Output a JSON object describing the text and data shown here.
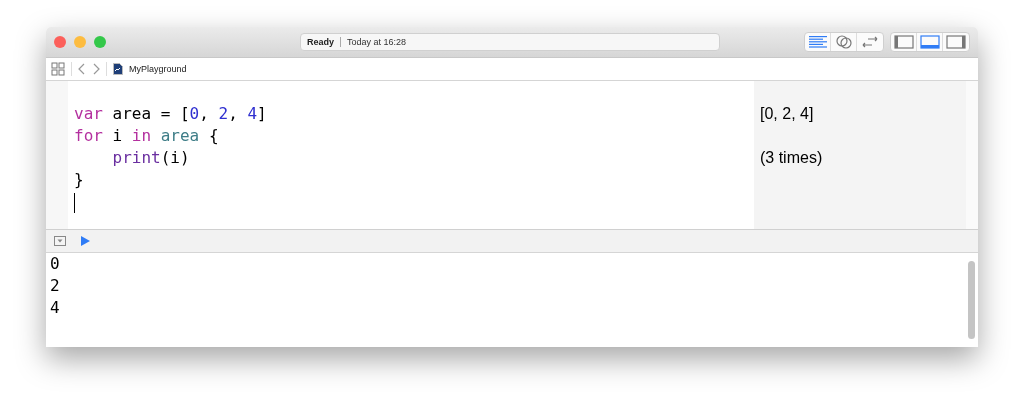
{
  "window": {
    "title_status": "Ready",
    "title_time": "Today at 16:28"
  },
  "toolbar": {
    "editor_modes": [
      {
        "kind": "standard",
        "selected": true
      },
      {
        "kind": "assistant",
        "selected": false
      },
      {
        "kind": "version",
        "selected": false
      }
    ],
    "panels": [
      {
        "kind": "left",
        "selected": false
      },
      {
        "kind": "bottom",
        "selected": true
      },
      {
        "kind": "right",
        "selected": false
      }
    ]
  },
  "jump_bar": {
    "file": "MyPlayground"
  },
  "editor": {
    "lines": [
      {
        "tokens": [
          {
            "text": "var",
            "kind": "keyword"
          },
          {
            "text": " area = [",
            "kind": "plain"
          },
          {
            "text": "0",
            "kind": "number"
          },
          {
            "text": ", ",
            "kind": "plain"
          },
          {
            "text": "2",
            "kind": "number"
          },
          {
            "text": ", ",
            "kind": "plain"
          },
          {
            "text": "4",
            "kind": "number"
          },
          {
            "text": "]",
            "kind": "plain"
          }
        ],
        "result": "[0, 2, 4]"
      },
      {
        "tokens": [
          {
            "text": "for",
            "kind": "keyword"
          },
          {
            "text": " i ",
            "kind": "plain"
          },
          {
            "text": "in",
            "kind": "keyword"
          },
          {
            "text": " area",
            "kind": "variable"
          },
          {
            "text": " {",
            "kind": "plain"
          }
        ]
      },
      {
        "tokens": [
          {
            "text": "    print",
            "kind": "function"
          },
          {
            "text": "(i)",
            "kind": "plain"
          }
        ],
        "result": "(3 times)"
      },
      {
        "tokens": [
          {
            "text": "}",
            "kind": "plain"
          }
        ]
      }
    ]
  },
  "console": {
    "lines": [
      "0",
      "2",
      "4"
    ]
  }
}
